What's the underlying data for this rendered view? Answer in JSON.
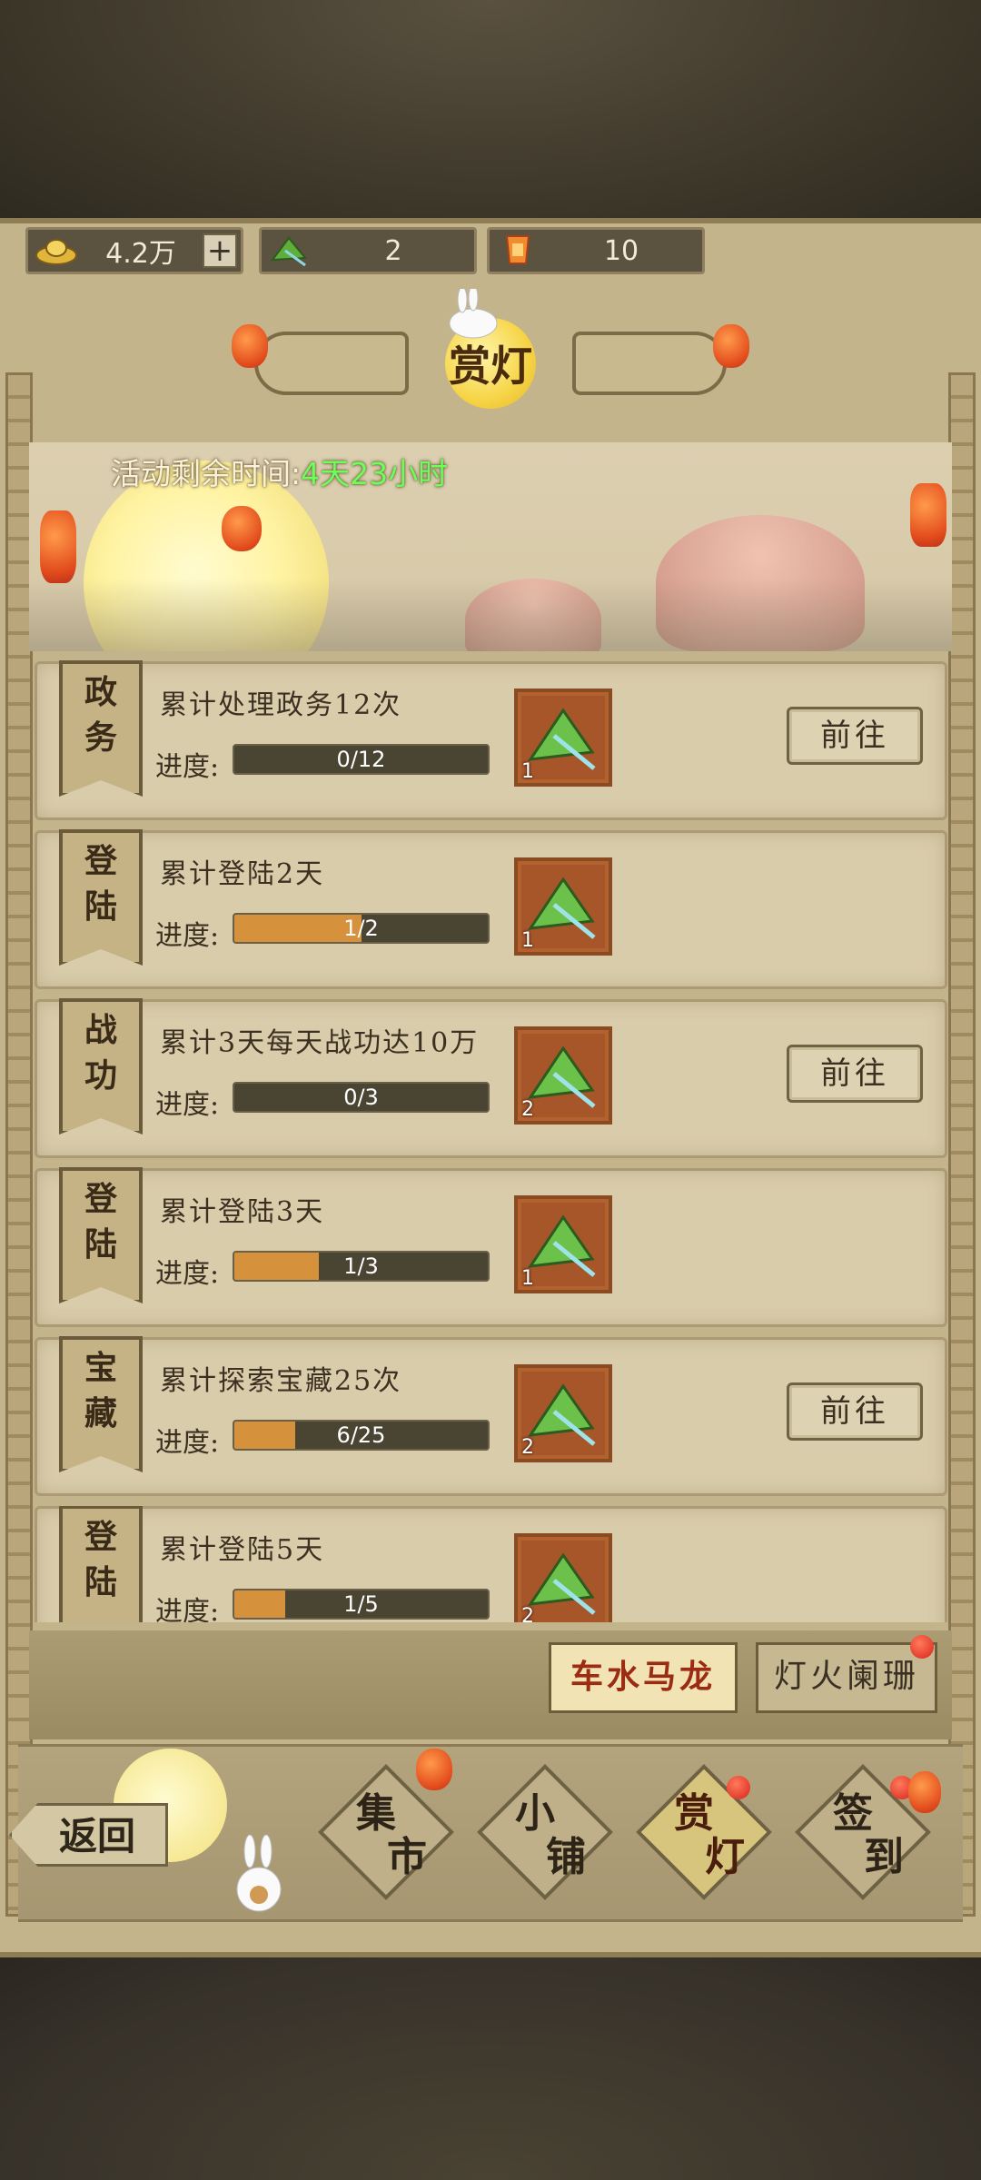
{
  "currency": {
    "gold": {
      "icon": "gold-ingot-icon",
      "value": "4.2万"
    },
    "zongzi": {
      "icon": "zongzi-icon",
      "value": "2"
    },
    "lantern": {
      "icon": "sky-lantern-icon",
      "value": "10"
    },
    "add_label": "+"
  },
  "title": "赏灯",
  "timer": {
    "label": "活动剩余时间:",
    "value": "4天23小时"
  },
  "tasks": [
    {
      "tag": "政务",
      "title": "累计处理政务12次",
      "progress_label": "进度:",
      "progress_text": "0/12",
      "progress": 0.0,
      "reward_count": "1",
      "button": "前往"
    },
    {
      "tag": "登陆",
      "title": "累计登陆2天",
      "progress_label": "进度:",
      "progress_text": "1/2",
      "progress": 0.5,
      "reward_count": "1",
      "button": ""
    },
    {
      "tag": "战功",
      "title": "累计3天每天战功达10万",
      "progress_label": "进度:",
      "progress_text": "0/3",
      "progress": 0.0,
      "reward_count": "2",
      "button": "前往"
    },
    {
      "tag": "登陆",
      "title": "累计登陆3天",
      "progress_label": "进度:",
      "progress_text": "1/3",
      "progress": 0.333,
      "reward_count": "1",
      "button": ""
    },
    {
      "tag": "宝藏",
      "title": "累计探索宝藏25次",
      "progress_label": "进度:",
      "progress_text": "6/25",
      "progress": 0.24,
      "reward_count": "2",
      "button": "前往"
    },
    {
      "tag": "登陆",
      "title": "累计登陆5天",
      "progress_label": "进度:",
      "progress_text": "1/5",
      "progress": 0.2,
      "reward_count": "2",
      "button": ""
    }
  ],
  "sub_tabs": {
    "active": "车水马龙",
    "other": "灯火阑珊"
  },
  "nav": {
    "back": "返回",
    "items": [
      {
        "l1": "集",
        "l2": "市"
      },
      {
        "l1": "小",
        "l2": "铺"
      },
      {
        "l1": "赏",
        "l2": "灯"
      },
      {
        "l1": "签",
        "l2": "到"
      }
    ]
  },
  "colors": {
    "accent_green": "#6bff57",
    "progress_fill": "#d6913c",
    "active_tab_text": "#9b2b12"
  }
}
